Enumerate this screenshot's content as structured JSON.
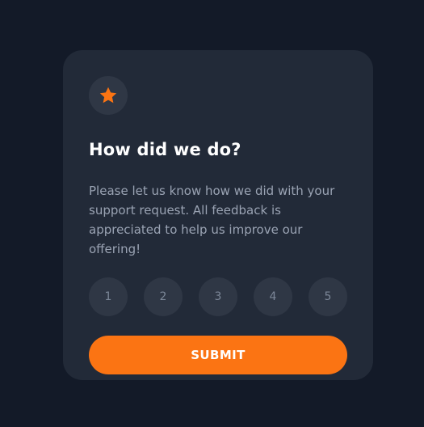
{
  "card": {
    "icon": "star-icon",
    "title": "How did we do?",
    "description": "Please let us know how we did with your support request. All feedback is appreciated to help us improve our offering!",
    "ratings": [
      "1",
      "2",
      "3",
      "4",
      "5"
    ],
    "submit_label": "SUBMIT"
  },
  "colors": {
    "background": "#131a28",
    "card": "#222a38",
    "accent": "#fb7413",
    "circle": "#2f3745",
    "muted_text": "#9aa3b3"
  }
}
